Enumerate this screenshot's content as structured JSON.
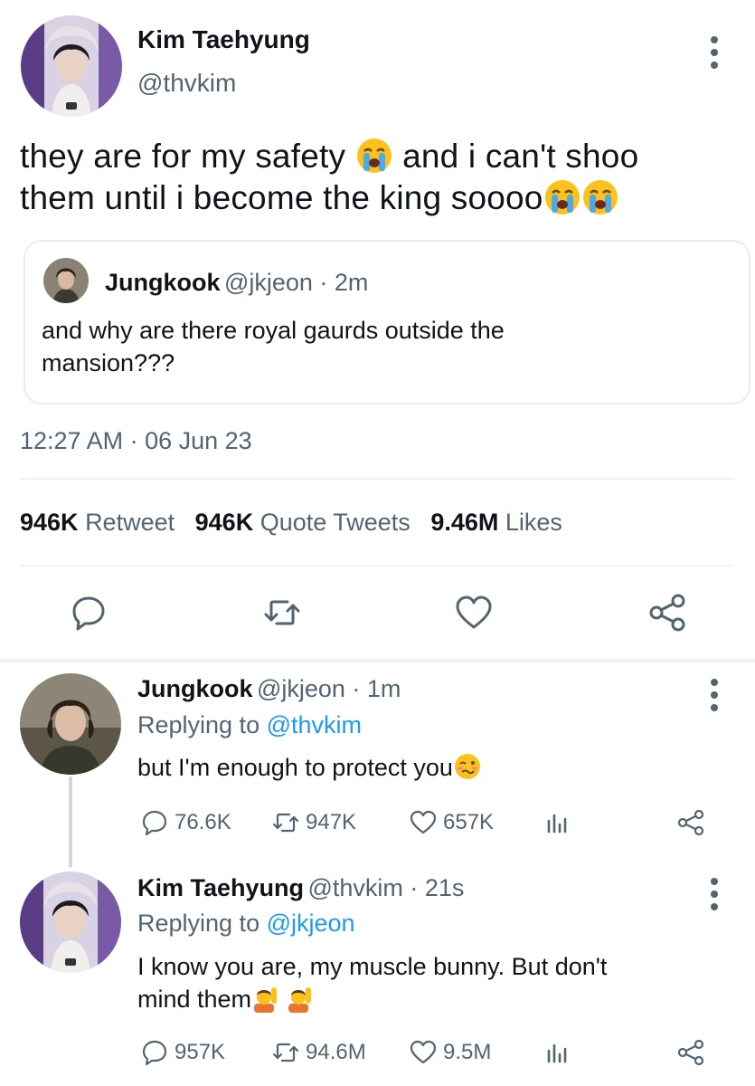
{
  "tweet": {
    "author_name": "Kim Taehyung",
    "author_handle": "@thvkim",
    "avatar_icon": "avatar-taehyung",
    "text_line1": "they are for my safety ",
    "text_line1b": " and i can't shoo",
    "text_line2": "them until i become the king soooo",
    "emoji_icon": "loudly-crying-face-emoji",
    "timestamp": "12:27 AM · 06 Jun 23",
    "quote": {
      "name": "Jungkook",
      "meta": "@jkjeon · 2m",
      "text_line1": "and why are there royal gaurds outside the",
      "text_line2": "mansion???"
    },
    "stats": {
      "retweets_count": "946K",
      "retweets_label": "Retweet",
      "quotes_count": "946K",
      "quotes_label": "Quote Tweets",
      "likes_count": "9.46M",
      "likes_label": "Likes"
    }
  },
  "replies": [
    {
      "name": "Jungkook",
      "meta": "@jkjeon · 1m",
      "replying_prefix": "Replying to ",
      "replying_to": "@thvkim",
      "text": "but I'm enough to protect you",
      "emoji_icon": "woozy-face-emoji",
      "comments": "76.6K",
      "retweets": "947K",
      "likes": "657K"
    },
    {
      "name": "Kim Taehyung",
      "meta": "@thvkim · 21s",
      "replying_prefix": "Replying to ",
      "replying_to": "@jkjeon",
      "text_line1": "I know you are, my muscle bunny. But don't",
      "text_line2": "mind them",
      "emoji_icon": "person-raising-hand-emoji",
      "comments": "957K",
      "retweets": "94.6M",
      "likes": "9.5M"
    }
  ],
  "colors": {
    "text": "#0f1419",
    "secondary": "#536471",
    "link": "#1d9bf0",
    "border": "#e6ecf0"
  }
}
